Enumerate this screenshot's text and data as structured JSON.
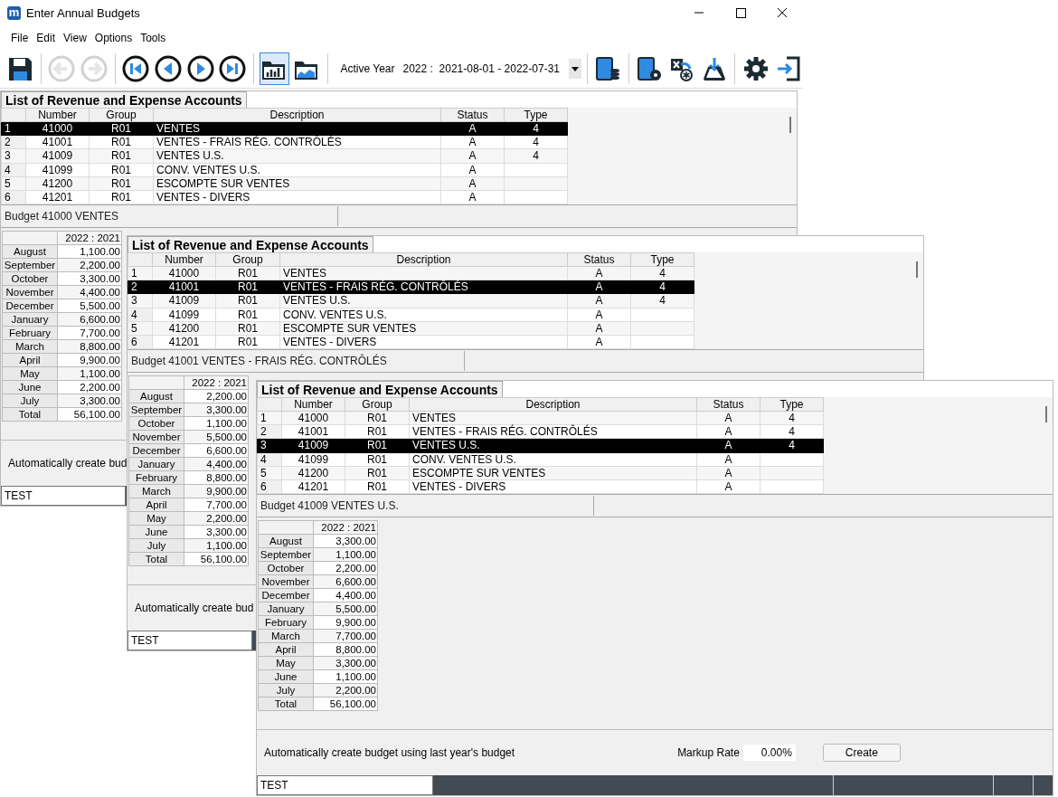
{
  "window": {
    "title": "Enter Annual Budgets",
    "app_icon_letter": "m"
  },
  "menu": [
    "File",
    "Edit",
    "View",
    "Options",
    "Tools"
  ],
  "toolbar_left": [
    {
      "kind": "save",
      "disabled": false,
      "selected": false
    },
    {
      "kind": "back",
      "disabled": true,
      "selected": false
    },
    {
      "kind": "forward",
      "disabled": true,
      "selected": false
    },
    {
      "kind": "first",
      "disabled": false,
      "selected": false
    },
    {
      "kind": "previous",
      "disabled": false,
      "selected": false
    },
    {
      "kind": "next",
      "disabled": false,
      "selected": false
    },
    {
      "kind": "last",
      "disabled": false,
      "selected": false
    },
    {
      "kind": "chart_folder",
      "disabled": false,
      "selected": true
    },
    {
      "kind": "graph_folder",
      "disabled": false,
      "selected": false
    }
  ],
  "active_year": {
    "label": "Active Year",
    "value": "2022 :  2021-08-01 - 2022-07-31"
  },
  "toolbar_right": [
    {
      "kind": "book_coins",
      "disabled": false,
      "selected": false
    },
    {
      "kind": "book_gear",
      "disabled": false,
      "selected": false
    },
    {
      "kind": "sheet_star",
      "disabled": false,
      "selected": false
    },
    {
      "kind": "download",
      "disabled": false,
      "selected": false
    },
    {
      "kind": "settings",
      "disabled": false,
      "selected": false
    },
    {
      "kind": "exit",
      "disabled": false,
      "selected": false
    }
  ],
  "panels": [
    {
      "tab": "List of Revenue and Expense Accounts",
      "columns": [
        "Number",
        "Group",
        "Description",
        "Status",
        "Type"
      ],
      "rows": [
        {
          "index": "1",
          "number": "41000",
          "group": "R01",
          "description": "VENTES",
          "status": "A",
          "type": "4",
          "selected": true
        },
        {
          "index": "2",
          "number": "41001",
          "group": "R01",
          "description": "VENTES - FRAIS RÉG. CONTRÔLÉS",
          "status": "A",
          "type": "4",
          "selected": false
        },
        {
          "index": "3",
          "number": "41009",
          "group": "R01",
          "description": "VENTES U.S.",
          "status": "A",
          "type": "4",
          "selected": false
        },
        {
          "index": "4",
          "number": "41099",
          "group": "R01",
          "description": "CONV. VENTES U.S.",
          "status": "A",
          "type": "",
          "selected": false
        },
        {
          "index": "5",
          "number": "41200",
          "group": "R01",
          "description": "ESCOMPTE SUR VENTES",
          "status": "A",
          "type": "",
          "selected": false
        },
        {
          "index": "6",
          "number": "41201",
          "group": "R01",
          "description": "VENTES - DIVERS",
          "status": "A",
          "type": "",
          "selected": false
        }
      ],
      "budget_title": "Budget 41000 VENTES",
      "budget_header": "2022 :  2021",
      "months": [
        {
          "month": "August",
          "amount": "1,100.00"
        },
        {
          "month": "September",
          "amount": "2,200.00"
        },
        {
          "month": "October",
          "amount": "3,300.00"
        },
        {
          "month": "November",
          "amount": "4,400.00"
        },
        {
          "month": "December",
          "amount": "5,500.00"
        },
        {
          "month": "January",
          "amount": "6,600.00"
        },
        {
          "month": "February",
          "amount": "7,700.00"
        },
        {
          "month": "March",
          "amount": "8,800.00"
        },
        {
          "month": "April",
          "amount": "9,900.00"
        },
        {
          "month": "May",
          "amount": "1,100.00"
        },
        {
          "month": "June",
          "amount": "2,200.00"
        },
        {
          "month": "July",
          "amount": "3,300.00"
        },
        {
          "month": "Total",
          "amount": "56,100.00"
        }
      ],
      "auto_text": "Automatically create bud",
      "status_field": "TEST"
    },
    {
      "tab": "List of Revenue and Expense Accounts",
      "columns": [
        "Number",
        "Group",
        "Description",
        "Status",
        "Type"
      ],
      "rows": [
        {
          "index": "1",
          "number": "41000",
          "group": "R01",
          "description": "VENTES",
          "status": "A",
          "type": "4",
          "selected": false
        },
        {
          "index": "2",
          "number": "41001",
          "group": "R01",
          "description": "VENTES - FRAIS RÉG. CONTRÔLÉS",
          "status": "A",
          "type": "4",
          "selected": true
        },
        {
          "index": "3",
          "number": "41009",
          "group": "R01",
          "description": "VENTES U.S.",
          "status": "A",
          "type": "4",
          "selected": false
        },
        {
          "index": "4",
          "number": "41099",
          "group": "R01",
          "description": "CONV. VENTES U.S.",
          "status": "A",
          "type": "",
          "selected": false
        },
        {
          "index": "5",
          "number": "41200",
          "group": "R01",
          "description": "ESCOMPTE SUR VENTES",
          "status": "A",
          "type": "",
          "selected": false
        },
        {
          "index": "6",
          "number": "41201",
          "group": "R01",
          "description": "VENTES - DIVERS",
          "status": "A",
          "type": "",
          "selected": false
        }
      ],
      "budget_title": "Budget 41001 VENTES - FRAIS RÉG. CONTRÔLÉS",
      "budget_header": "2022 :  2021",
      "months": [
        {
          "month": "August",
          "amount": "2,200.00"
        },
        {
          "month": "September",
          "amount": "3,300.00"
        },
        {
          "month": "October",
          "amount": "1,100.00"
        },
        {
          "month": "November",
          "amount": "5,500.00"
        },
        {
          "month": "December",
          "amount": "6,600.00"
        },
        {
          "month": "January",
          "amount": "4,400.00"
        },
        {
          "month": "February",
          "amount": "8,800.00"
        },
        {
          "month": "March",
          "amount": "9,900.00"
        },
        {
          "month": "April",
          "amount": "7,700.00"
        },
        {
          "month": "May",
          "amount": "2,200.00"
        },
        {
          "month": "June",
          "amount": "3,300.00"
        },
        {
          "month": "July",
          "amount": "1,100.00"
        },
        {
          "month": "Total",
          "amount": "56,100.00"
        }
      ],
      "auto_text": "Automatically create bud",
      "status_field": "TEST"
    },
    {
      "tab": "List of Revenue and Expense Accounts",
      "columns": [
        "Number",
        "Group",
        "Description",
        "Status",
        "Type"
      ],
      "rows": [
        {
          "index": "1",
          "number": "41000",
          "group": "R01",
          "description": "VENTES",
          "status": "A",
          "type": "4",
          "selected": false
        },
        {
          "index": "2",
          "number": "41001",
          "group": "R01",
          "description": "VENTES - FRAIS RÉG. CONTRÔLÉS",
          "status": "A",
          "type": "4",
          "selected": false
        },
        {
          "index": "3",
          "number": "41009",
          "group": "R01",
          "description": "VENTES U.S.",
          "status": "A",
          "type": "4",
          "selected": true
        },
        {
          "index": "4",
          "number": "41099",
          "group": "R01",
          "description": "CONV. VENTES U.S.",
          "status": "A",
          "type": "",
          "selected": false
        },
        {
          "index": "5",
          "number": "41200",
          "group": "R01",
          "description": "ESCOMPTE SUR VENTES",
          "status": "A",
          "type": "",
          "selected": false
        },
        {
          "index": "6",
          "number": "41201",
          "group": "R01",
          "description": "VENTES - DIVERS",
          "status": "A",
          "type": "",
          "selected": false
        }
      ],
      "budget_title": "Budget 41009 VENTES U.S.",
      "budget_header": "2022 :  2021",
      "months": [
        {
          "month": "August",
          "amount": "3,300.00"
        },
        {
          "month": "September",
          "amount": "1,100.00"
        },
        {
          "month": "October",
          "amount": "2,200.00"
        },
        {
          "month": "November",
          "amount": "6,600.00"
        },
        {
          "month": "December",
          "amount": "4,400.00"
        },
        {
          "month": "January",
          "amount": "5,500.00"
        },
        {
          "month": "February",
          "amount": "9,900.00"
        },
        {
          "month": "March",
          "amount": "7,700.00"
        },
        {
          "month": "April",
          "amount": "8,800.00"
        },
        {
          "month": "May",
          "amount": "3,300.00"
        },
        {
          "month": "June",
          "amount": "1,100.00"
        },
        {
          "month": "July",
          "amount": "2,200.00"
        },
        {
          "month": "Total",
          "amount": "56,100.00"
        }
      ],
      "auto_text": "Automatically create budget using last year's budget",
      "markup_label": "Markup Rate",
      "markup_value": "0.00%",
      "create_button": "Create",
      "status_field": "TEST"
    }
  ]
}
